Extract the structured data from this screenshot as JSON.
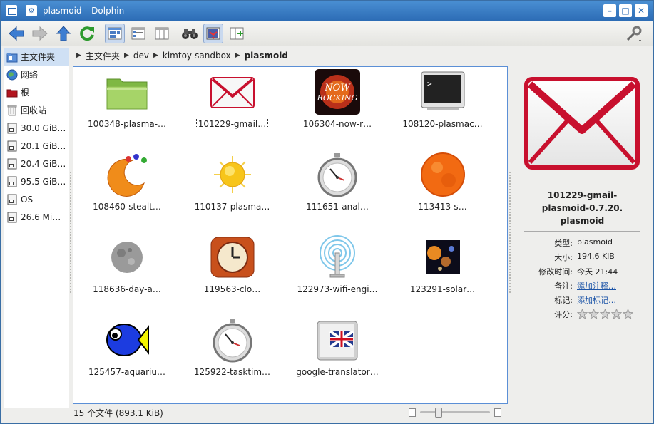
{
  "window": {
    "title": "plasmoid – Dolphin",
    "menu_glyph": "⚙",
    "buttons": [
      "minimize",
      "maximize",
      "close"
    ],
    "btn_glyphs": {
      "minimize": "–",
      "maximize": "□",
      "close": "✕"
    }
  },
  "toolbar": {
    "buttons": [
      "back",
      "forward",
      "up",
      "reload",
      "icons-view",
      "details-view",
      "columns-view",
      "find",
      "preview",
      "split"
    ],
    "active": "preview",
    "right": "configure"
  },
  "places": [
    {
      "label": "主文件夹",
      "icon": "home-icon",
      "selected": true
    },
    {
      "label": "网络",
      "icon": "network-icon"
    },
    {
      "label": "根",
      "icon": "root-folder-icon"
    },
    {
      "label": "回收站",
      "icon": "trash-icon"
    },
    {
      "label": "30.0 GiB…",
      "icon": "drive-icon"
    },
    {
      "label": "20.1 GiB…",
      "icon": "drive-icon"
    },
    {
      "label": "20.4 GiB…",
      "icon": "drive-icon"
    },
    {
      "label": "95.5 GiB…",
      "icon": "drive-icon"
    },
    {
      "label": "OS",
      "icon": "drive-icon"
    },
    {
      "label": "26.6 Mi…",
      "icon": "drive-icon"
    }
  ],
  "breadcrumb": [
    "主文件夹",
    "dev",
    "kimtoy-sandbox",
    "plasmoid"
  ],
  "files": [
    {
      "label": "100348-plasma-…",
      "icon": "folder-icon"
    },
    {
      "label": "101229-gmail…",
      "icon": "gmail-icon",
      "focused": true
    },
    {
      "label": "106304-now-r…",
      "icon": "now-rocking-icon"
    },
    {
      "label": "108120-plasmac…",
      "icon": "terminal-icon"
    },
    {
      "label": "108460-stealt…",
      "icon": "stealth-icon"
    },
    {
      "label": "110137-plasma…",
      "icon": "sun-icon"
    },
    {
      "label": "111651-anal…",
      "icon": "stopwatch-icon"
    },
    {
      "label": "113413-s…",
      "icon": "sun-surface-icon"
    },
    {
      "label": "118636-day-a…",
      "icon": "moon-icon"
    },
    {
      "label": "119563-clo…",
      "icon": "clock-icon"
    },
    {
      "label": "122973-wifi-engi…",
      "icon": "wifi-icon"
    },
    {
      "label": "123291-solar…",
      "icon": "solar-system-icon"
    },
    {
      "label": "125457-aquariu…",
      "icon": "fish-icon"
    },
    {
      "label": "125922-tasktim…",
      "icon": "stopwatch-icon"
    },
    {
      "label": "google-translator…",
      "icon": "translator-icon"
    }
  ],
  "info": {
    "name": "101229-gmail-\nplasmoid-0.7.20.\nplasmoid",
    "rows": [
      {
        "key": "类型:",
        "value": "plasmoid"
      },
      {
        "key": "大小:",
        "value": "194.6 KiB"
      },
      {
        "key": "修改时间:",
        "value": "今天 21:44"
      },
      {
        "key": "备注:",
        "value": "添加注释…",
        "link": true
      },
      {
        "key": "标记:",
        "value": "添加标记…",
        "link": true
      },
      {
        "key": "评分:",
        "value": ""
      }
    ],
    "rating": 0,
    "rating_max": 5
  },
  "status": {
    "text": "15 个文件 (893.1 KiB)",
    "zoom": 0.27
  },
  "colors": {
    "accent": "#2c6cb5",
    "link": "#1d55a8",
    "gmail_red": "#c8102e"
  }
}
